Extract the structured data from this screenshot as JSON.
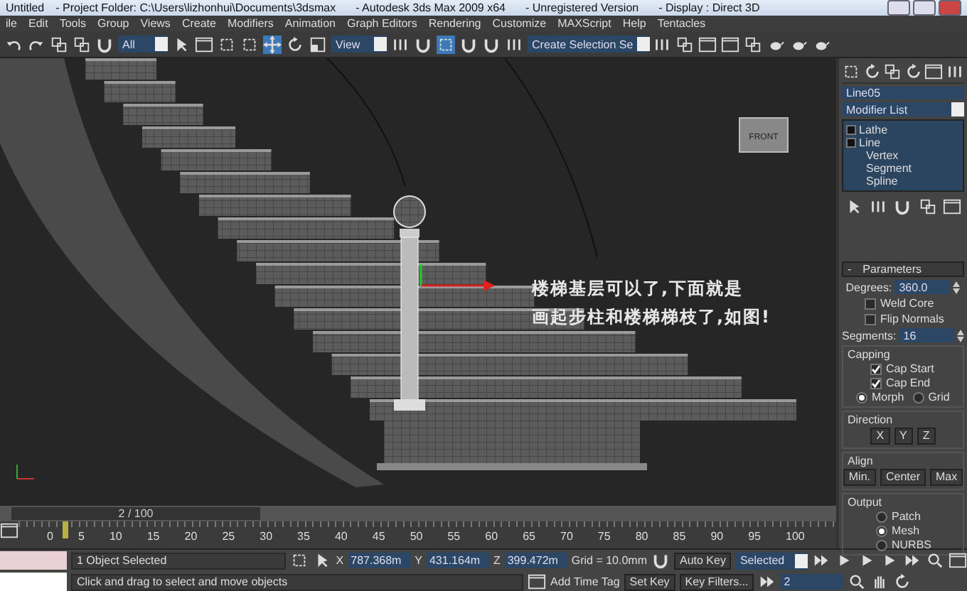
{
  "title_bar": {
    "document": "Untitled",
    "parts": [
      "- Project Folder: C:\\Users\\lizhonhui\\Documents\\3dsmax",
      "- Autodesk 3ds Max  2009 x64",
      "- Unregistered Version",
      "- Display : Direct 3D"
    ]
  },
  "menu_bar": [
    "ile",
    "Edit",
    "Tools",
    "Group",
    "Views",
    "Create",
    "Modifiers",
    "Animation",
    "Graph Editors",
    "Rendering",
    "Customize",
    "MAXScript",
    "Help",
    "Tentacles"
  ],
  "toolbar": {
    "selection_filter": "All",
    "reference_coordinate_system": "View",
    "named_selection": "Create Selection Se",
    "transform_tools": [
      {
        "selected": true
      },
      {
        "selected": false
      },
      {
        "selected": false
      }
    ],
    "angle_snap_on": true
  },
  "viewport": {
    "view_cube": "FRONT",
    "annotation": [
      "楼梯基层可以了,下面就是",
      "画起步柱和楼梯梯枝了,如图!"
    ]
  },
  "command_panel": {
    "object_name": "Line05",
    "modifier_list": "Modifier List",
    "stack": [
      {
        "label": "Lathe"
      },
      {
        "label": "Line",
        "children": [
          {
            "label": "Vertex"
          },
          {
            "label": "Segment"
          },
          {
            "label": "Spline"
          }
        ]
      }
    ],
    "rollout": {
      "sign": "-",
      "title": "Parameters"
    },
    "degrees": {
      "label": "Degrees:",
      "value": "360.0"
    },
    "options": [
      {
        "label": "Weld Core",
        "checked": false
      },
      {
        "label": "Flip Normals",
        "checked": false
      }
    ],
    "segments": {
      "label": "Segments:",
      "value": "16"
    },
    "capping": {
      "title": "Capping",
      "checks": [
        {
          "label": "Cap Start",
          "checked": true
        },
        {
          "label": "Cap End",
          "checked": true
        }
      ],
      "radios": [
        {
          "label": "Morph",
          "selected": true
        },
        {
          "label": "Grid",
          "selected": false
        }
      ]
    },
    "direction": {
      "title": "Direction",
      "buttons": [
        "X",
        "Y",
        "Z"
      ]
    },
    "align": {
      "title": "Align",
      "buttons": [
        "Min.",
        "Center",
        "Max"
      ]
    },
    "output": {
      "title": "Output",
      "radios": [
        {
          "label": "Patch",
          "selected": false
        },
        {
          "label": "Mesh",
          "selected": true
        },
        {
          "label": "NURBS",
          "selected": false
        }
      ]
    }
  },
  "time_slider": {
    "label": "2 / 100",
    "level": 0.02
  },
  "track_bar": {
    "frame_labels": [
      "0",
      "5",
      "10",
      "15",
      "20",
      "25",
      "30",
      "35",
      "40",
      "45",
      "50",
      "55",
      "60",
      "65",
      "70",
      "75",
      "80",
      "85",
      "90",
      "95",
      "100"
    ]
  },
  "status_bar": {
    "selection": "1 Object Selected",
    "prompt": "Click and drag to select and move objects",
    "coordinates": [
      {
        "axis": "X",
        "value": "787.368m"
      },
      {
        "axis": "Y",
        "value": "431.164m"
      },
      {
        "axis": "Z",
        "value": "399.472m"
      }
    ],
    "grid": "Grid = 10.0mm",
    "add_time_tag": "Add Time Tag",
    "auto_key": "Auto Key",
    "key_mode": "Selected",
    "set_key": "Set Key",
    "key_filters": "Key Filters...",
    "current_frame": "2"
  }
}
